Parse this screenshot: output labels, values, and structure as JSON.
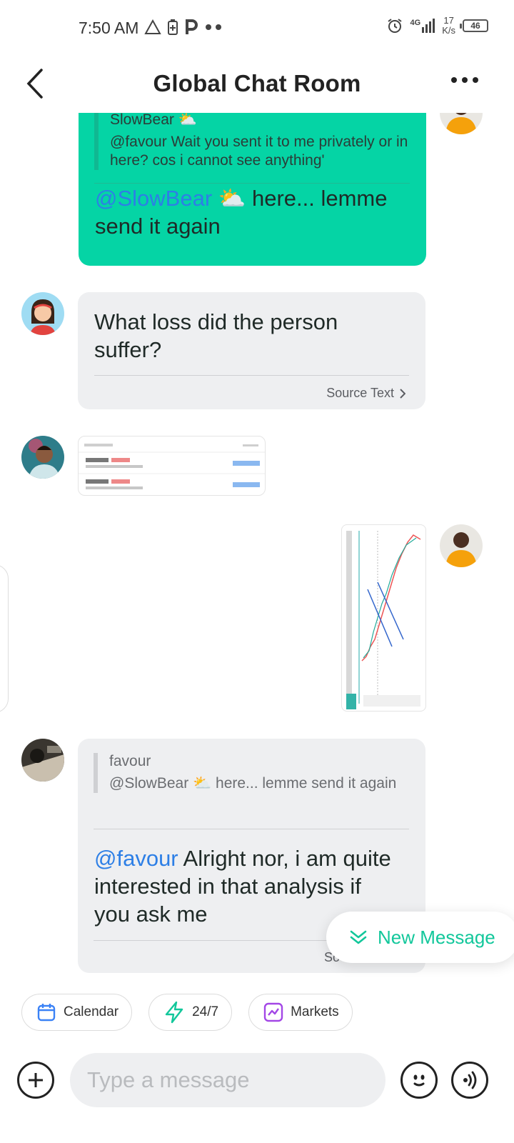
{
  "status_bar": {
    "time": "7:50 AM",
    "network": "4G",
    "speed_value": "17",
    "speed_unit": "K/s",
    "battery": "46"
  },
  "header": {
    "title": "Global Chat Room"
  },
  "messages": [
    {
      "quote_author": "SlowBear ⛅",
      "quote_text": "@favour Wait you sent it to me privately or in here? cos i cannot see anything'",
      "mention": "@SlowBear ⛅",
      "text": " here... lemme send it again"
    },
    {
      "text": "What loss did the person suffer?",
      "source_link": "Source Text"
    },
    {
      "quote_author": "favour",
      "quote_text": "@SlowBear ⛅ here... lemme send it again",
      "mention": "@favour",
      "text": "  Alright nor, i am quite interested in that analysis if you ask me",
      "source_link": "So"
    }
  ],
  "new_message_label": "New Message",
  "quick_actions": [
    {
      "label": "Calendar",
      "icon": "calendar-icon"
    },
    {
      "label": "24/7",
      "icon": "lightning-icon"
    },
    {
      "label": "Markets",
      "icon": "chart-icon"
    }
  ],
  "composer": {
    "placeholder": "Type a message"
  },
  "colors": {
    "accent": "#05d4a5",
    "mention": "#2d7fe6",
    "bubble_grey": "#eeeff1"
  }
}
